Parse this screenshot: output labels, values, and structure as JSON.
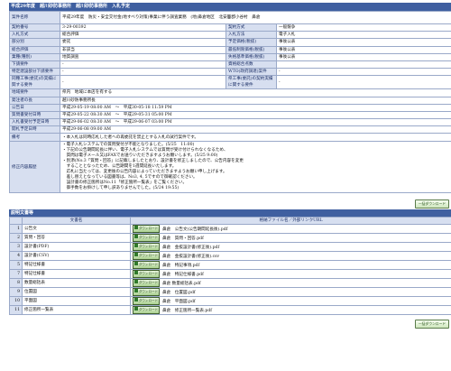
{
  "header": {
    "title": "平成29年度　越川砂防事務所　越川砂防事務所　入札予定"
  },
  "info": {
    "rows": [
      {
        "k1": "案件名称",
        "v1": "平成29年度　防災・安全交付金(地すべり対策)事業に伴う調査業務　(地)鼻倉地区　北安曇郡小谷村　鼻倉"
      },
      {
        "k1": "契約番号",
        "v1": "3-29-00392",
        "k2": "契約方式",
        "v2": "一般競争"
      },
      {
        "k1": "入札方式",
        "v1": "総合評価",
        "k2": "入札方法",
        "v2": "電子入札"
      },
      {
        "k1": "部分別",
        "v1": "委託",
        "k2": "予定価格(税抜)",
        "v2": "事後公表"
      },
      {
        "k1": "総合評価",
        "v1": "非該当",
        "k2": "最低制限価格(税抜)",
        "v2": "事後公表"
      },
      {
        "k1": "業種(種別)",
        "v1": "地質調査",
        "k2": "失格基準価格(税抜)",
        "v2": "事後公表"
      },
      {
        "k1": "下請要件",
        "v1": "-",
        "k2": "資格総合点数",
        "v2": ""
      },
      {
        "k1": "特定建設部分下請要件",
        "v1": "-",
        "k2": "WTO(政府調達)案件",
        "v2": "-"
      },
      {
        "k1": "同種工事(委託)の実績に関する要件",
        "v1": "-",
        "k2": "県工事(委託)の契約実績に関する要件",
        "v2": "-"
      },
      {
        "k1": "地域要件",
        "v1": "県内　地域に本店を有する"
      },
      {
        "k1": "発注者の長",
        "v1": "越川砂防事務所長"
      },
      {
        "k1": "公告日",
        "v1": "平成29-05-19 08:00 AM　～　平成30-05-18 11:59 PM"
      },
      {
        "k1": "質問書受付日時",
        "v1": "平成29-05-22 08:30 AM　～　平成29-05-31 05:00 PM"
      },
      {
        "k1": "入札書受付予定日時",
        "v1": "平成29-06-02 08:30 AM　～　平成29-06-07 03:00 PM"
      },
      {
        "k1": "開札予定日時",
        "v1": "平成29-06-08 09:00 AM"
      },
      {
        "k1": "備考",
        "v1": "・本入札は同時応札した者への再委託を禁止とする入札の試行案件です。"
      }
    ],
    "revision_label": "修正内容履歴",
    "revision_lines": [
      "・電子入札システムでの質問受付が不能となりました。(5/25　11:00)",
      "・下記の公告期間延長に伴い、電子入札システムでは質問が受け付けられなくなるため、",
      "　質問は電子メール又はFAXでお送りいただきますようお願いします。(5/25 9:00)",
      "・別添(No.3「質問・回答」に記載しましたとおり、設計書を修正しましたので、公告内容を変更",
      "　することとなったため、公告期間を1週間延長いたします。",
      "　応札に当たっては、変更後の公告内容によっていただきますようお願い申し上げます。",
      "　差し替えとなっている図書等は、No3, 4, 5ですので御確認ください。",
      "　設計書の修正箇所はNo.11「修正箇所一覧表」をご覧ください。",
      "　御手数をお掛けして申し訳ありませんでした。(5/24 19:55)"
    ]
  },
  "button_all_download": "一括ダウンロード",
  "files": {
    "section_title": "説明文書等",
    "col_name": "文書名",
    "col_link": "格納ファイル名／外部リンクURL",
    "download_label": "ダウンロード",
    "items": [
      {
        "no": "1",
        "name": "公告文",
        "file": "鼻倉　公告文(公告期間延長後).pdf"
      },
      {
        "no": "2",
        "name": "質問・回答",
        "file": "鼻倉　質問・回答.pdf"
      },
      {
        "no": "3",
        "name": "設計書(PDF)",
        "file": "鼻倉　金抜設計書(修正後).pdf"
      },
      {
        "no": "4",
        "name": "設計書(CSV)",
        "file": "鼻倉　金抜設計書(修正後).csv"
      },
      {
        "no": "5",
        "name": "特記仕様書",
        "file": "鼻倉　特記事項.pdf"
      },
      {
        "no": "7",
        "name": "特記仕様書",
        "file": "鼻倉　特記仕様書.pdf"
      },
      {
        "no": "8",
        "name": "数量総括表",
        "file": "鼻倉 数量総括表.pdf"
      },
      {
        "no": "9",
        "name": "位置図",
        "file": "鼻倉　位置図.pdf"
      },
      {
        "no": "10",
        "name": "平面図",
        "file": "鼻倉　平面図.pdf"
      },
      {
        "no": "11",
        "name": "修正箇所一覧表",
        "file": "鼻倉　修正箇所一覧表.pdf"
      }
    ]
  }
}
